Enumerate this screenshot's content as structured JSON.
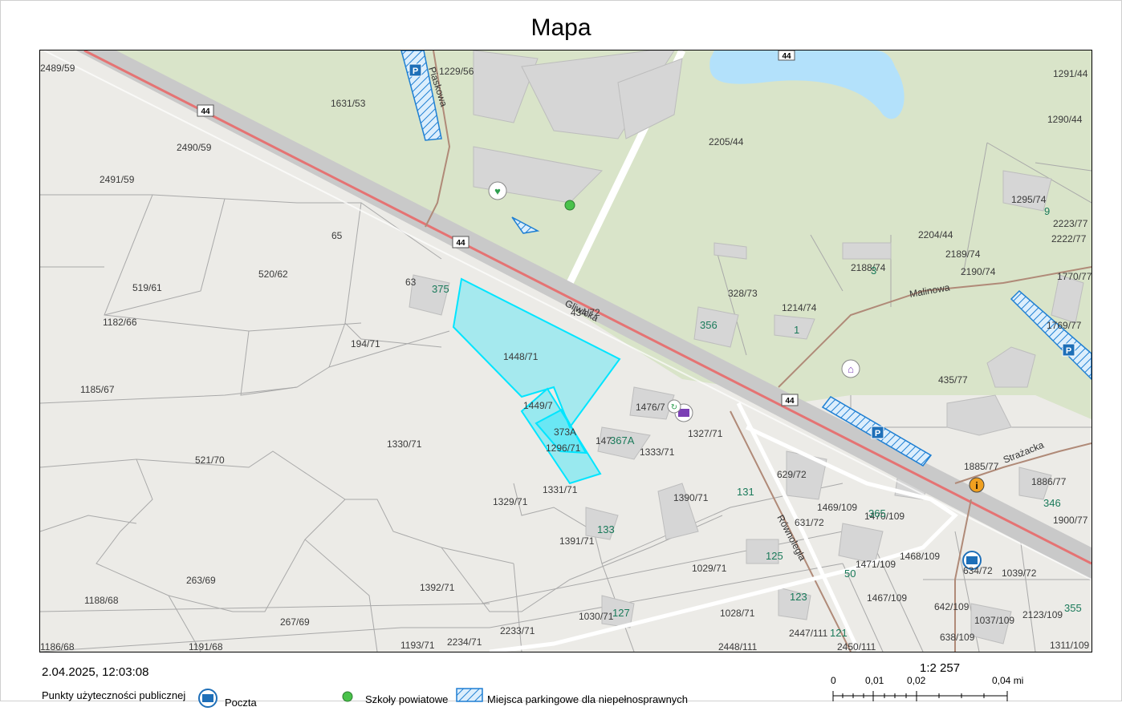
{
  "title": "Mapa",
  "date": "2.04.2025, 12:03:08",
  "scale": {
    "ratio": "1:2 257",
    "ticks": [
      "0",
      "0,01",
      "0,02",
      "0,04 mi"
    ]
  },
  "legend": {
    "group_title": "Punkty użyteczności publicznej",
    "item1": "Poczta",
    "item2": "Szkoły powiatowe",
    "item3": "Miejsca parkingowe dla niepełnosprawnych"
  },
  "map": {
    "road_shield": "44",
    "streets": [
      "Gliwicka",
      "Piaskowa",
      "Malinowa",
      "Równoległa",
      "Strażacka"
    ],
    "parcels": [
      "2489/59",
      "1229/56",
      "1631/53",
      "2490/59",
      "2491/59",
      "65",
      "519/61",
      "520/62",
      "63",
      "1182/66",
      "194/71",
      "1448/71",
      "1185/67",
      "1449/7",
      "373A",
      "1296/71",
      "147",
      "367A",
      "1476/7",
      "1327/71",
      "1330/71",
      "1333/71",
      "521/70",
      "1329/71",
      "1331/71",
      "1390/71",
      "131",
      "629/72",
      "1469/109",
      "1470/109",
      "365",
      "631/72",
      "133",
      "1391/71",
      "125",
      "1471/109",
      "50",
      "1468/109",
      "634/72",
      "1039/72",
      "1029/71",
      "123",
      "1467/109",
      "642/109",
      "1037/109",
      "2123/109",
      "355",
      "263/69",
      "1392/71",
      "1188/68",
      "267/69",
      "1030/71",
      "127",
      "1028/71",
      "2447/111",
      "121",
      "1186/68",
      "1191/68",
      "1193/71",
      "2234/71",
      "2233/71",
      "2448/111",
      "2450/111",
      "638/109",
      "1311/109",
      "2205/44",
      "1291/44",
      "1290/44",
      "1295/74",
      "9",
      "2223/77",
      "2222/77",
      "2204/44",
      "2189/74",
      "2188/74",
      "3",
      "328/73",
      "356",
      "1214/74",
      "1",
      "2190/74",
      "1770/77",
      "1769/77",
      "435/77",
      "1885/77",
      "1886/77",
      "346",
      "1900/77",
      "434/72",
      "375"
    ],
    "colors": {
      "background": "#ecebe7",
      "green_area": "#d9e4c9",
      "water": "#b3e1fb",
      "road_red": "#e57373",
      "selected": "#00e5ff",
      "parking": "#1e7fd3",
      "house_number": "#1a7a5a"
    },
    "poi_icons": [
      "health-icon",
      "school-dot-icon",
      "church-icon",
      "library-icon",
      "info-icon",
      "post-office-icon",
      "parking-icon"
    ]
  }
}
